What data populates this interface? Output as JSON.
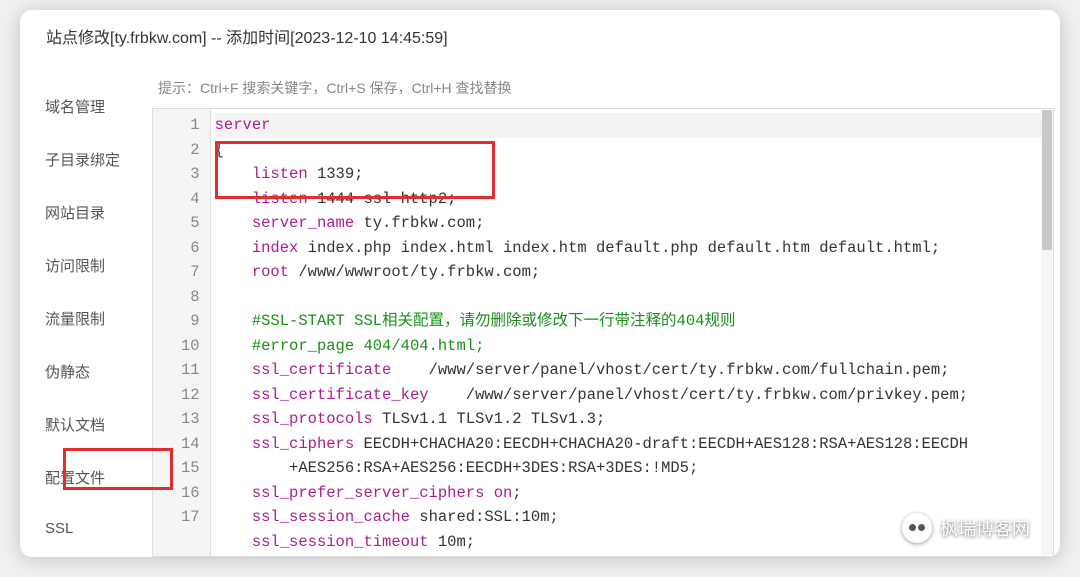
{
  "title": "站点修改[ty.frbkw.com] -- 添加时间[2023-12-10 14:45:59]",
  "hint": "提示：Ctrl+F 搜索关键字，Ctrl+S 保存，Ctrl+H 查找替换",
  "sidebar": {
    "items": [
      {
        "label": "域名管理"
      },
      {
        "label": "子目录绑定"
      },
      {
        "label": "网站目录"
      },
      {
        "label": "访问限制"
      },
      {
        "label": "流量限制"
      },
      {
        "label": "伪静态"
      },
      {
        "label": "默认文档"
      },
      {
        "label": "配置文件"
      },
      {
        "label": "SSL"
      }
    ],
    "active_index": 7
  },
  "code": {
    "lines": [
      {
        "n": 1,
        "hl": true,
        "segs": [
          {
            "t": "server",
            "c": "kw"
          }
        ]
      },
      {
        "n": 2,
        "segs": [
          {
            "t": "{",
            "c": ""
          }
        ]
      },
      {
        "n": 3,
        "segs": [
          {
            "t": "    ",
            "c": ""
          },
          {
            "t": "listen",
            "c": "kw"
          },
          {
            "t": " 1339;",
            "c": ""
          }
        ]
      },
      {
        "n": 4,
        "segs": [
          {
            "t": "    ",
            "c": ""
          },
          {
            "t": "listen",
            "c": "kw"
          },
          {
            "t": " 1444 ssl http2;",
            "c": ""
          }
        ]
      },
      {
        "n": 5,
        "segs": [
          {
            "t": "    ",
            "c": ""
          },
          {
            "t": "server_name",
            "c": "kw"
          },
          {
            "t": " ty.frbkw.com;",
            "c": ""
          }
        ]
      },
      {
        "n": 6,
        "segs": [
          {
            "t": "    ",
            "c": ""
          },
          {
            "t": "index",
            "c": "kw"
          },
          {
            "t": " index.php index.html index.htm default.php default.htm default.html;",
            "c": ""
          }
        ]
      },
      {
        "n": 7,
        "segs": [
          {
            "t": "    ",
            "c": ""
          },
          {
            "t": "root",
            "c": "kw"
          },
          {
            "t": " /www/wwwroot/ty.frbkw.com;",
            "c": ""
          }
        ]
      },
      {
        "n": 8,
        "segs": []
      },
      {
        "n": 9,
        "segs": [
          {
            "t": "    ",
            "c": ""
          },
          {
            "t": "#SSL-START SSL相关配置，请勿删除或修改下一行带注释的404规则",
            "c": "cmt"
          }
        ]
      },
      {
        "n": 10,
        "segs": [
          {
            "t": "    ",
            "c": ""
          },
          {
            "t": "#error_page 404/404.html;",
            "c": "cmt"
          }
        ]
      },
      {
        "n": 11,
        "segs": [
          {
            "t": "    ",
            "c": ""
          },
          {
            "t": "ssl_certificate",
            "c": "kw"
          },
          {
            "t": "    /www/server/panel/vhost/cert/ty.frbkw.com/fullchain.pem;",
            "c": ""
          }
        ]
      },
      {
        "n": 12,
        "segs": [
          {
            "t": "    ",
            "c": ""
          },
          {
            "t": "ssl_certificate_key",
            "c": "kw"
          },
          {
            "t": "    /www/server/panel/vhost/cert/ty.frbkw.com/privkey.pem;",
            "c": ""
          }
        ]
      },
      {
        "n": 13,
        "segs": [
          {
            "t": "    ",
            "c": ""
          },
          {
            "t": "ssl_protocols",
            "c": "kw"
          },
          {
            "t": " TLSv1.1 TLSv1.2 TLSv1.3;",
            "c": ""
          }
        ]
      },
      {
        "n": 14,
        "segs": [
          {
            "t": "    ",
            "c": ""
          },
          {
            "t": "ssl_ciphers",
            "c": "kw"
          },
          {
            "t": " EECDH+CHACHA20:EECDH+CHACHA20-draft:EECDH+AES128:RSA+AES128:EECDH",
            "c": ""
          }
        ]
      },
      {
        "n": 0,
        "cont": true,
        "segs": [
          {
            "t": "        +AES256:RSA+AES256:EECDH+3DES:RSA+3DES:!MD5;",
            "c": ""
          }
        ]
      },
      {
        "n": 15,
        "segs": [
          {
            "t": "    ",
            "c": ""
          },
          {
            "t": "ssl_prefer_server_ciphers",
            "c": "kw"
          },
          {
            "t": " ",
            "c": ""
          },
          {
            "t": "on",
            "c": "kw"
          },
          {
            "t": ";",
            "c": ""
          }
        ]
      },
      {
        "n": 16,
        "segs": [
          {
            "t": "    ",
            "c": ""
          },
          {
            "t": "ssl_session_cache",
            "c": "kw"
          },
          {
            "t": " shared:SSL:10m;",
            "c": ""
          }
        ]
      },
      {
        "n": 17,
        "segs": [
          {
            "t": "    ",
            "c": ""
          },
          {
            "t": "ssl_session_timeout",
            "c": "kw"
          },
          {
            "t": " 10m;",
            "c": ""
          }
        ]
      }
    ]
  },
  "watermark": "枫瑞博客网"
}
